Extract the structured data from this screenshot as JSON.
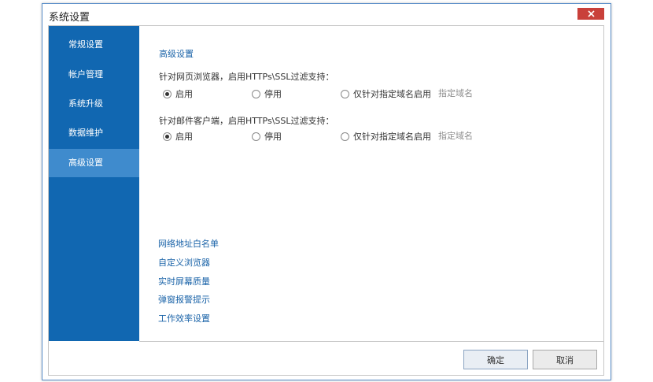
{
  "window": {
    "title": "系统设置"
  },
  "sidebar": {
    "items": [
      {
        "label": "常规设置"
      },
      {
        "label": "帐户管理"
      },
      {
        "label": "系统升级"
      },
      {
        "label": "数据维护"
      },
      {
        "label": "高级设置",
        "active": true
      }
    ]
  },
  "content": {
    "section_title": "高级设置",
    "browser": {
      "question": "针对网页浏览器，启用HTTPs\\SSL过滤支持：",
      "options": [
        "启用",
        "停用",
        "仅针对指定域名启用"
      ],
      "selected": "启用",
      "domain_link": "指定域名"
    },
    "mail": {
      "question": "针对邮件客户端，启用HTTPs\\SSL过滤支持：",
      "options": [
        "启用",
        "停用",
        "仅针对指定域名启用"
      ],
      "selected": "启用",
      "domain_link": "指定域名"
    },
    "links": [
      "网络地址白名单",
      "自定义浏览器",
      "实时屏幕质量",
      "弹窗报警提示",
      "工作效率设置"
    ]
  },
  "footer": {
    "ok_label": "确定",
    "cancel_label": "取消"
  },
  "colors": {
    "sidebar": "#1167b1",
    "sidebar_active": "#3f8bcd",
    "link": "#1a63a8",
    "close_button": "#c9403a"
  }
}
